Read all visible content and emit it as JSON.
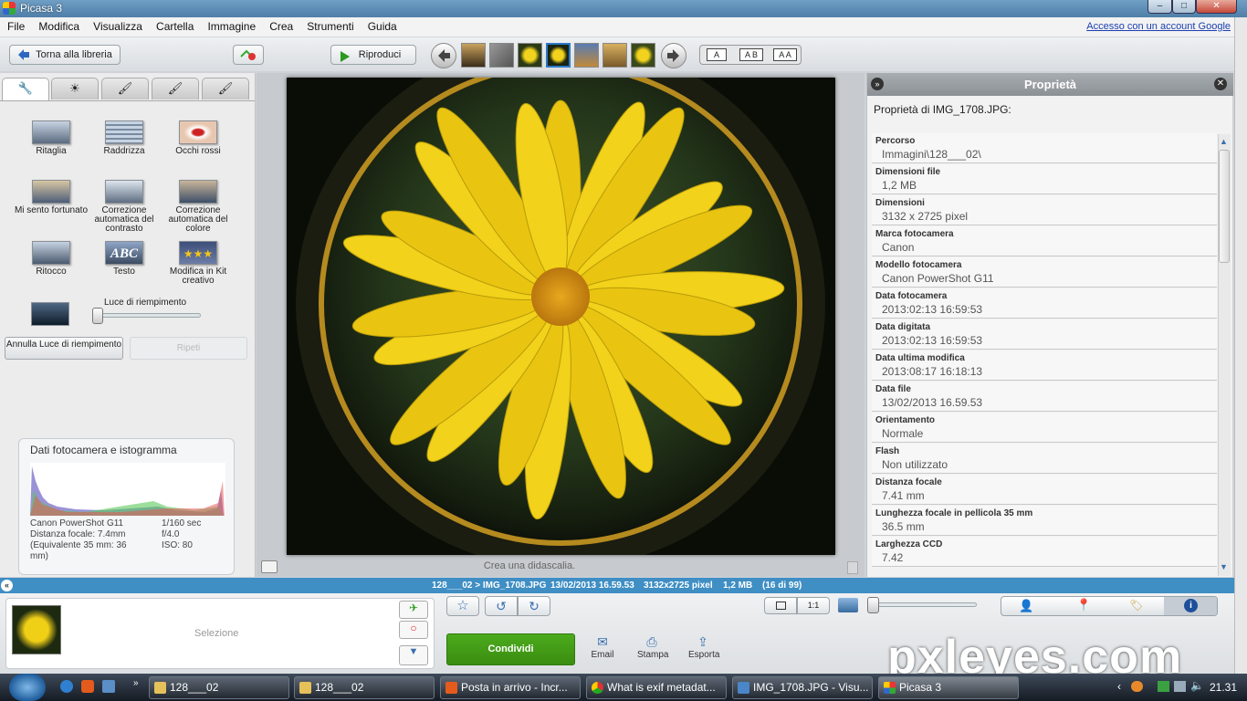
{
  "window": {
    "title": "Picasa 3",
    "minimize": "–",
    "maximize": "□",
    "close": "✕"
  },
  "menu": {
    "items": [
      "File",
      "Modifica",
      "Visualizza",
      "Cartella",
      "Immagine",
      "Crea",
      "Strumenti",
      "Guida"
    ],
    "account_link": "Accesso con un account Google"
  },
  "toolbar": {
    "back_label": "Torna alla libreria",
    "play_label": "Riproduci",
    "caption_a": "A",
    "caption_ab": "A B",
    "caption_aa": "A A"
  },
  "left": {
    "tools": [
      "Ritaglia",
      "Raddrizza",
      "Occhi rossi",
      "Mi sento fortunato",
      "Correzione automatica del contrasto",
      "Correzione automatica del colore",
      "Ritocco",
      "Testo",
      "Modifica in Kit creativo"
    ],
    "fill_light_label": "Luce di riempimento",
    "fill_light_value": 0,
    "undo_label": "Annulla Luce di riempimento",
    "redo_label": "Ripeti",
    "hist_title": "Dati fotocamera e istogramma",
    "hist_camera": "Canon PowerShot G11",
    "hist_focal": "Distanza focale: 7.4mm",
    "hist_equiv": "(Equivalente 35 mm:  36 mm)",
    "hist_shutter": "1/160 sec",
    "hist_aperture": "f/4.0",
    "hist_iso": "ISO: 80"
  },
  "photo": {
    "caption_placeholder": "Crea una didascalia."
  },
  "props": {
    "title": "Proprietà",
    "subtitle": "Proprietà di IMG_1708.JPG:",
    "rows": [
      {
        "k": "Percorso",
        "v": "Immagini\\128___02\\"
      },
      {
        "k": "Dimensioni file",
        "v": "1,2 MB"
      },
      {
        "k": "Dimensioni",
        "v": "3132 x 2725 pixel"
      },
      {
        "k": "Marca fotocamera",
        "v": "Canon"
      },
      {
        "k": "Modello fotocamera",
        "v": "Canon PowerShot G11"
      },
      {
        "k": "Data fotocamera",
        "v": "2013:02:13 16:59:53"
      },
      {
        "k": "Data digitata",
        "v": "2013:02:13 16:59:53"
      },
      {
        "k": "Data ultima modifica",
        "v": "2013:08:17 16:18:13"
      },
      {
        "k": "Data file",
        "v": "13/02/2013 16.59.53"
      },
      {
        "k": "Orientamento",
        "v": "Normale"
      },
      {
        "k": "Flash",
        "v": "Non utilizzato"
      },
      {
        "k": "Distanza focale",
        "v": "7.41 mm"
      },
      {
        "k": "Lunghezza focale in pellicola 35 mm",
        "v": "36.5 mm"
      },
      {
        "k": "Larghezza CCD",
        "v": "7.42"
      }
    ]
  },
  "status": {
    "path": "128___02 > IMG_1708.JPG",
    "date": "13/02/2013 16.59.53",
    "size": "3132x2725 pixel",
    "filesize": "1,2 MB",
    "index": "(16 di 99)"
  },
  "tray": {
    "selection_label": "Selezione",
    "share_label": "Condividi",
    "email_label": "Email",
    "print_label": "Stampa",
    "export_label": "Esporta",
    "zoom_1to1": "1:1"
  },
  "taskbar": {
    "items": [
      "128___02",
      "128___02",
      "Posta in arrivo - Incr...",
      "What is exif metadat...",
      "IMG_1708.JPG - Visu...",
      "Picasa 3"
    ],
    "clock": "21.31"
  },
  "watermark": "pxleyes.com",
  "colors": {
    "accent": "#3f8ec4",
    "share": "#3f9a14",
    "taskbar": "#1f2732"
  }
}
